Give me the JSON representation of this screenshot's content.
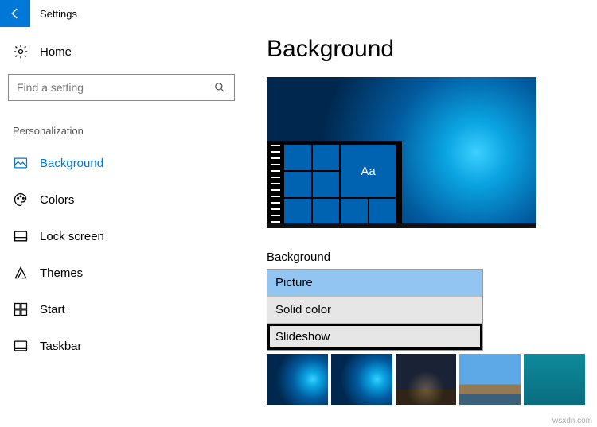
{
  "titlebar": {
    "label": "Settings"
  },
  "sidebar": {
    "home": "Home",
    "search_placeholder": "Find a setting",
    "category": "Personalization",
    "items": [
      {
        "label": "Background",
        "icon": "picture-icon",
        "active": true
      },
      {
        "label": "Colors",
        "icon": "palette-icon",
        "active": false
      },
      {
        "label": "Lock screen",
        "icon": "lockscreen-icon",
        "active": false
      },
      {
        "label": "Themes",
        "icon": "themes-icon",
        "active": false
      },
      {
        "label": "Start",
        "icon": "start-icon",
        "active": false
      },
      {
        "label": "Taskbar",
        "icon": "taskbar-icon",
        "active": false
      }
    ]
  },
  "main": {
    "title": "Background",
    "preview_tile_text": "Aa",
    "field_label": "Background",
    "dropdown": {
      "options": [
        "Picture",
        "Solid color",
        "Slideshow"
      ],
      "selected_index": 0,
      "highlighted_index": 2
    }
  },
  "watermark": "wsxdn.com"
}
